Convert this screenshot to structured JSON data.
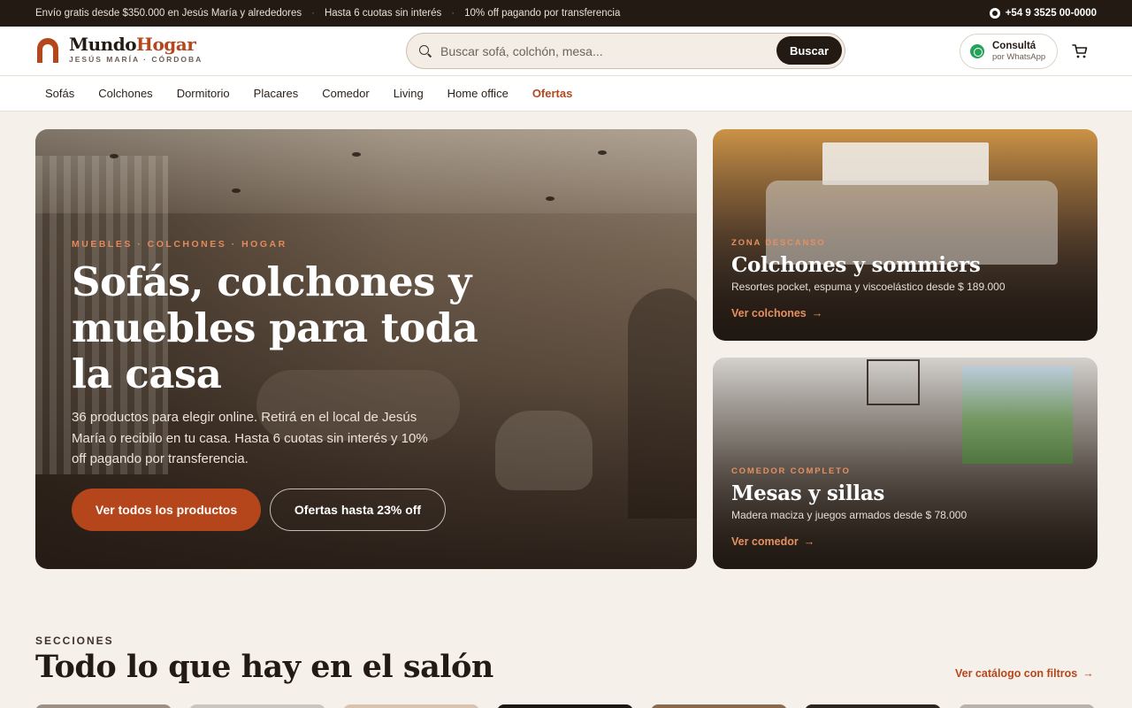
{
  "topbar": {
    "promos": [
      "Envío gratis desde $350.000 en Jesús María y alrededores",
      "Hasta 6 cuotas sin interés",
      "10% off pagando por transferencia"
    ],
    "separator": "·",
    "phone": "+54 9 3525 00-0000",
    "phone_icon": "whatsapp-icon"
  },
  "header": {
    "logo": {
      "name_part1": "Mundo",
      "name_part2": "Hogar",
      "tagline": "JESÚS MARÍA · CÓRDOBA"
    },
    "search": {
      "placeholder": "Buscar sofá, colchón, mesa...",
      "value": "",
      "button": "Buscar",
      "icon": "search-icon"
    },
    "whatsapp": {
      "line1": "Consultá",
      "line2": "por WhatsApp",
      "icon": "whatsapp-icon"
    },
    "cart_icon": "cart-icon"
  },
  "nav": {
    "items": [
      "Sofás",
      "Colchones",
      "Dormitorio",
      "Placares",
      "Comedor",
      "Living",
      "Home office",
      "Ofertas"
    ]
  },
  "hero": {
    "eyebrow": "MUEBLES · COLCHONES · HOGAR",
    "title": "Sofás, colchones y muebles para toda la casa",
    "text": "36 productos para elegir online. Retirá en el local de Jesús María o recibilo en tu casa. Hasta 6 cuotas sin interés y 10% off pagando por transferencia.",
    "cta_primary": "Ver todos los productos",
    "cta_secondary": "Ofertas hasta 23% off"
  },
  "cards": [
    {
      "eyebrow": "ZONA DESCANSO",
      "title": "Colchones y sommiers",
      "desc": "Resortes pocket, espuma y viscoelástico desde $ 189.000",
      "link": "Ver colchones",
      "arrow": "→"
    },
    {
      "eyebrow": "COMEDOR COMPLETO",
      "title": "Mesas y sillas",
      "desc": "Madera maciza y juegos armados desde $ 78.000",
      "link": "Ver comedor",
      "arrow": "→"
    }
  ],
  "sections": {
    "eyebrow": "SECCIONES",
    "title": "Todo lo que hay en el salón",
    "link": "Ver catálogo con filtros",
    "arrow": "→"
  },
  "colors": {
    "brand_dark": "#231a14",
    "accent": "#b5471d",
    "accent_light": "#e69060",
    "background": "#f5f0ea"
  }
}
